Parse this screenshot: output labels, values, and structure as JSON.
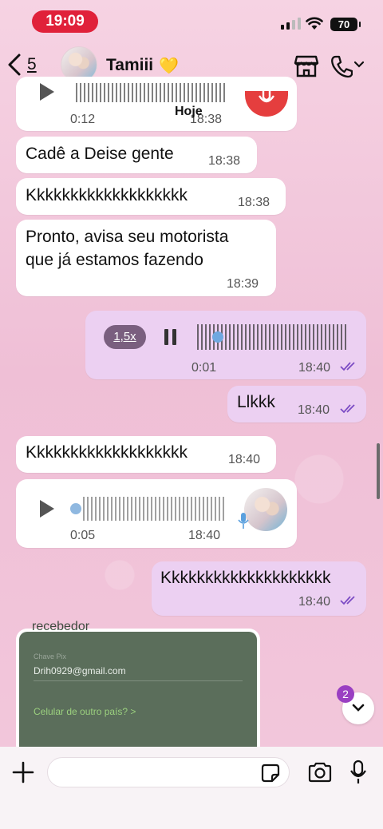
{
  "status_bar": {
    "time": "19:09",
    "battery": "70"
  },
  "header": {
    "back_count": "5",
    "contact_name": "Tamiii",
    "name_emoji": "💛"
  },
  "date_chip": "Hoje",
  "messages": [
    {
      "type": "voice",
      "direction": "in",
      "duration": "0:12",
      "time": "18:38",
      "partial": true
    },
    {
      "type": "text",
      "direction": "in",
      "text": "Cadê a Deise gente",
      "time": "18:38"
    },
    {
      "type": "text",
      "direction": "in",
      "text": "Kkkkkkkkkkkkkkkkkkk",
      "time": "18:38"
    },
    {
      "type": "text",
      "direction": "in",
      "text_line1": "Pronto, avisa seu motorista",
      "text_line2": "que já estamos fazendo",
      "time": "18:39"
    },
    {
      "type": "voice",
      "direction": "out",
      "speed": "1,5x",
      "duration": "0:01",
      "time": "18:40",
      "read": true
    },
    {
      "type": "text",
      "direction": "out",
      "text": "Llkkk",
      "time": "18:40",
      "read": true
    },
    {
      "type": "text",
      "direction": "in",
      "text": "Kkkkkkkkkkkkkkkkkkk",
      "time": "18:40"
    },
    {
      "type": "voice",
      "direction": "in",
      "duration": "0:05",
      "time": "18:40"
    },
    {
      "type": "text",
      "direction": "out",
      "text": "Kkkkkkkkkkkkkkkkkkkk",
      "time": "18:40",
      "read": true
    },
    {
      "type": "image",
      "direction": "in",
      "content": {
        "title": "recebedor",
        "field_label": "Chave Pix",
        "email": "Drih0929@gmail.com",
        "link": "Celular de outro país? >"
      }
    }
  ],
  "unread_count": "2",
  "input": {
    "placeholder": ""
  },
  "colors": {
    "read_ticks": "#7b4bc4",
    "unread_badge": "#9a3fc2",
    "time_pill": "#e0213a"
  }
}
